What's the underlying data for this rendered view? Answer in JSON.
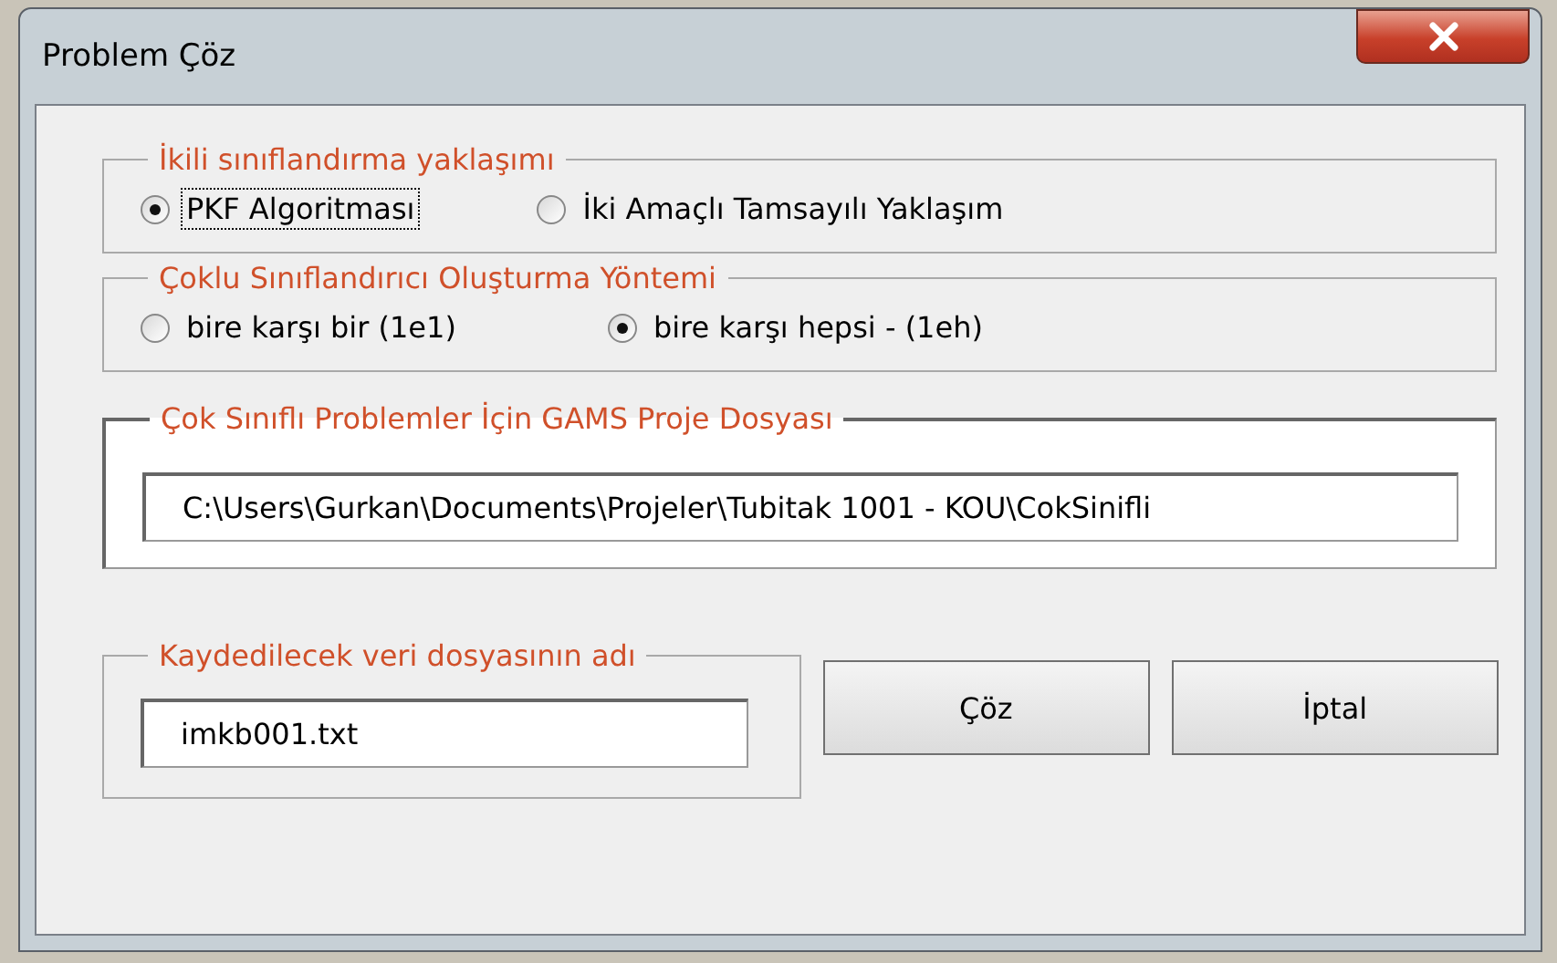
{
  "window": {
    "title": "Problem Çöz"
  },
  "groups": [
    {
      "title": "İkili sınıflandırma yaklaşımı",
      "kind": "radio",
      "options": [
        {
          "label": "PKF Algoritması",
          "selected": true,
          "focused": true
        },
        {
          "label": "İki Amaçlı Tamsayılı Yaklaşım",
          "selected": false,
          "focused": false
        }
      ]
    },
    {
      "title": "Çoklu Sınıflandırıcı Oluşturma Yöntemi",
      "kind": "radio",
      "options": [
        {
          "label": "bire karşı bir (1e1)",
          "selected": false,
          "focused": false
        },
        {
          "label": "bire karşı hepsi - (1eh)",
          "selected": true,
          "focused": false
        }
      ]
    },
    {
      "title": "Çok Sınıflı Problemler İçin GAMS Proje Dosyası",
      "kind": "field",
      "value": "C:\\Users\\Gurkan\\Documents\\Projeler\\Tubitak 1001 - KOU\\CokSinifli"
    }
  ],
  "file_group": {
    "title": "Kaydedilecek veri dosyasının adı",
    "value": "imkb001.txt"
  },
  "buttons": [
    "Çöz",
    "İptal"
  ]
}
